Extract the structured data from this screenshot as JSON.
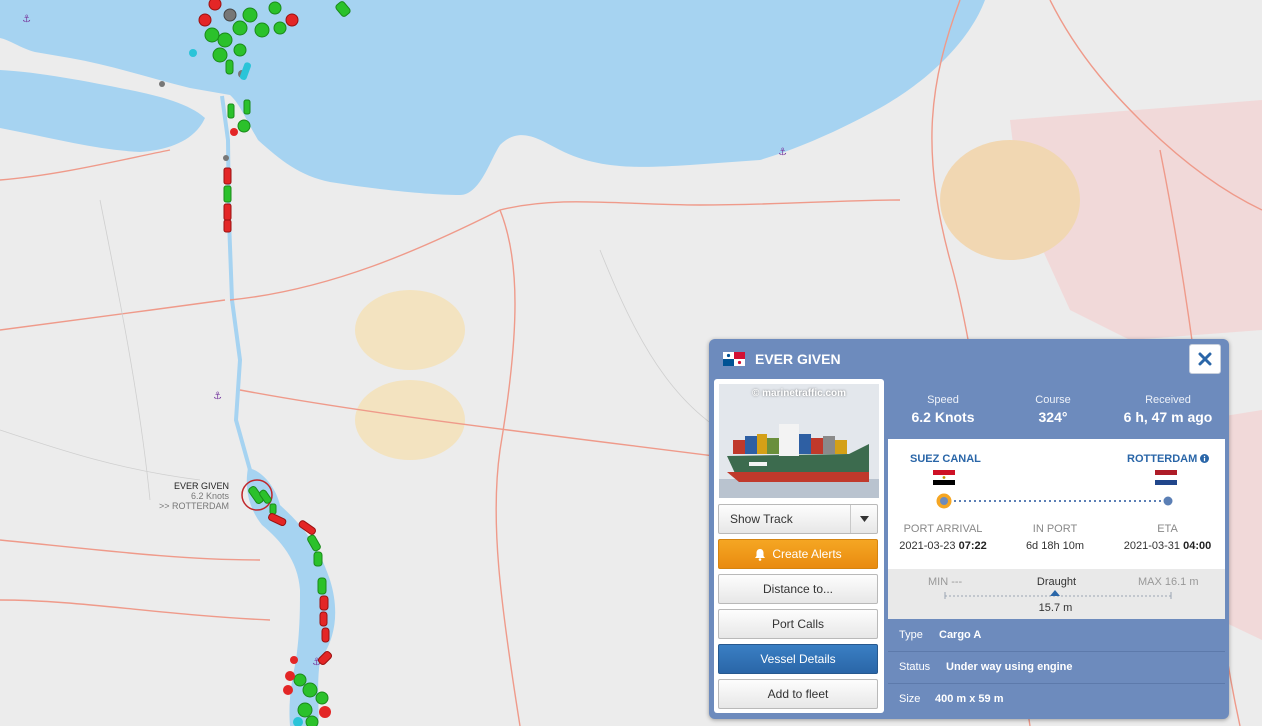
{
  "map": {
    "label": {
      "name": "EVER GIVEN",
      "speed": "6.2 Knots",
      "destination": ">> ROTTERDAM"
    },
    "colors": {
      "sea": "#a6d3f1",
      "land": "#ececec",
      "road": "#ef9a8a",
      "restricted": "#f1c3c3"
    }
  },
  "panel": {
    "flag_icon": "panama-flag-icon",
    "vessel_name": "EVER GIVEN",
    "close_icon": "close-icon",
    "photo_credit": "© marinetraffic.com",
    "buttons": {
      "show_track": "Show Track",
      "create_alerts": "Create Alerts",
      "distance": "Distance to...",
      "port_calls": "Port Calls",
      "vessel_details": "Vessel Details",
      "add_fleet": "Add to fleet"
    },
    "stats": {
      "speed_label": "Speed",
      "speed_value": "6.2 Knots",
      "course_label": "Course",
      "course_value": "324°",
      "received_label": "Received",
      "received_value": "6 h, 47 m ago"
    },
    "route": {
      "from": "SUEZ CANAL",
      "to": "ROTTERDAM",
      "progress": 0,
      "port_arrival_label": "PORT ARRIVAL",
      "port_arrival_date": "2021-03-23",
      "port_arrival_time": "07:22",
      "in_port_label": "IN PORT",
      "in_port_value": "6d 18h 10m",
      "eta_label": "ETA",
      "eta_date": "2021-03-31",
      "eta_time": "04:00"
    },
    "draught": {
      "min": "MIN ---",
      "label": "Draught",
      "max": "MAX 16.1 m",
      "value": "15.7 m"
    },
    "info": {
      "type_label": "Type",
      "type_value": "Cargo A",
      "status_label": "Status",
      "status_value": "Under way using engine",
      "size_label": "Size",
      "size_value": "400 m x 59 m"
    }
  }
}
